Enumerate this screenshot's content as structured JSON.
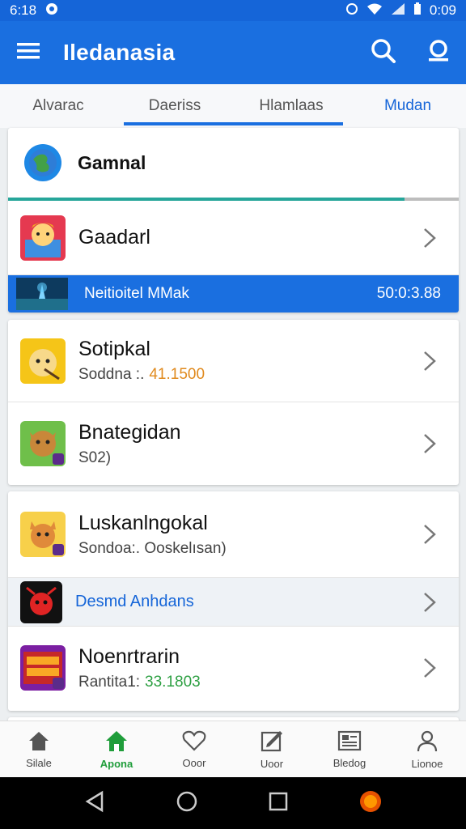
{
  "status_bar": {
    "time_left": "6:18",
    "time_right": "0:09"
  },
  "app_bar": {
    "title": "Iledanasia",
    "menu_icon": "hamburger-menu-icon",
    "search_icon": "search-icon",
    "account_icon": "account-icon"
  },
  "tabs": [
    {
      "label": "Alvarac"
    },
    {
      "label": "Daeriss"
    },
    {
      "label": "Hlamlaas"
    },
    {
      "label": "Mudan"
    }
  ],
  "featured": {
    "title": "Gamnal",
    "progress": 0.88,
    "item": {
      "title": "Gaadarl"
    },
    "banner": {
      "title": "Neitioitel MMak",
      "time": "50:0:3.88"
    }
  },
  "list1": [
    {
      "title": "Sotipkal",
      "sub_label": "Soddna :.",
      "sub_value": "41.1500",
      "value_color": "#e08a1e"
    },
    {
      "title": "Bnategidan",
      "sub_label": "S02)",
      "sub_value": "",
      "value_color": "#444444"
    }
  ],
  "list2": [
    {
      "title": "Luskanlngokal",
      "sub_label": "Sondoa:. Ooskelısan)",
      "sub_value": "",
      "value_color": "#444444"
    },
    {
      "link": "Desmd Anhdans"
    },
    {
      "title": "Noenrtrarin",
      "sub_label": "Rantita1:",
      "sub_value": "33.1803",
      "value_color": "#2ea043"
    }
  ],
  "bottom_nav": [
    {
      "label": "Silale",
      "icon": "home-icon"
    },
    {
      "label": "Apona",
      "icon": "home-icon"
    },
    {
      "label": "Ooor",
      "icon": "heart-icon"
    },
    {
      "label": "Uoor",
      "icon": "edit-icon"
    },
    {
      "label": "Bledog",
      "icon": "news-icon"
    },
    {
      "label": "Lionoe",
      "icon": "profile-icon"
    }
  ],
  "colors": {
    "primary": "#1a6fe0",
    "active_nav": "#1f9d3a"
  }
}
